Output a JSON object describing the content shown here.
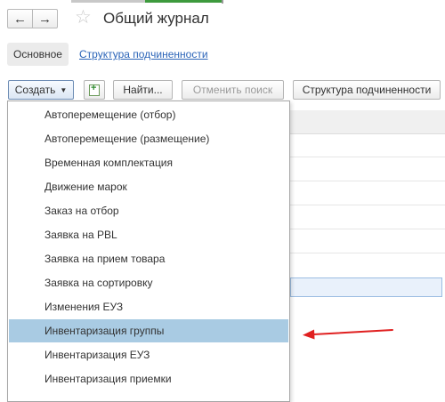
{
  "header": {
    "back_symbol": "←",
    "forward_symbol": "→",
    "favorite_symbol": "☆",
    "title": "Общий журнал"
  },
  "tabs": {
    "main_label": "Основное",
    "link_label": "Структура подчиненности"
  },
  "toolbar": {
    "create_label": "Создать",
    "create_caret": "▼",
    "find_label": "Найти...",
    "cancel_search_label": "Отменить поиск",
    "structure_label": "Структура подчиненности"
  },
  "create_menu": {
    "items": [
      "Автоперемещение (отбор)",
      "Автоперемещение (размещение)",
      "Временная комплектация",
      "Движение марок",
      "Заказ на отбор",
      "Заявка на PBL",
      "Заявка на прием товара",
      "Заявка на сортировку",
      "Изменения ЕУЗ",
      "Инвентаризация группы",
      "Инвентаризация ЕУЗ",
      "Инвентаризация приемки"
    ],
    "highlighted_index": 9
  },
  "colors": {
    "menu_highlight": "#a9cbe3",
    "link": "#2b64b8",
    "annotation_arrow": "#e02020",
    "tab_accent": "#3d9a3d"
  }
}
